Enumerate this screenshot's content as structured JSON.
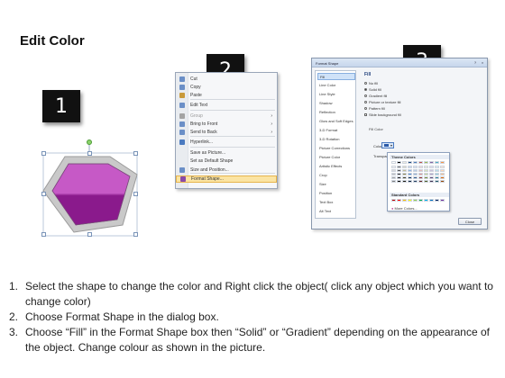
{
  "title": "Edit Color",
  "steps": [
    "1",
    "2",
    "3"
  ],
  "shape": {
    "fill_top": "#c659c6",
    "fill_bottom": "#8a1a8c",
    "outline": "#9b9b9b"
  },
  "context_menu": {
    "items": [
      {
        "label": "Cut",
        "icon": "scissors-icon"
      },
      {
        "label": "Copy",
        "icon": "copy-icon"
      },
      {
        "label": "Paste",
        "icon": "paste-icon"
      },
      {
        "label": "Edit Text",
        "icon": "edit-text-icon"
      },
      {
        "label": "Group",
        "icon": "group-icon",
        "submenu": true,
        "disabled": true
      },
      {
        "label": "Bring to Front",
        "icon": "bring-front-icon",
        "submenu": true
      },
      {
        "label": "Send to Back",
        "icon": "send-back-icon",
        "submenu": true
      },
      {
        "label": "Hyperlink...",
        "icon": "hyperlink-icon"
      },
      {
        "label": "Save as Picture...",
        "icon": ""
      },
      {
        "label": "Set as Default Shape",
        "icon": ""
      },
      {
        "label": "Size and Position...",
        "icon": "size-position-icon"
      },
      {
        "label": "Format Shape...",
        "icon": "format-shape-icon",
        "highlight": true
      }
    ],
    "submenu_arrow": "›"
  },
  "dialog": {
    "title": "Format Shape",
    "categories": [
      "Fill",
      "Line Color",
      "Line Style",
      "Shadow",
      "Reflection",
      "Glow and Soft Edges",
      "3-D Format",
      "3-D Rotation",
      "Picture Corrections",
      "Picture Color",
      "Artistic Effects",
      "Crop",
      "Size",
      "Position",
      "Text Box",
      "Alt Text"
    ],
    "section": "Fill",
    "options": [
      {
        "label": "No fill",
        "type": "radio",
        "on": false
      },
      {
        "label": "Solid fill",
        "type": "radio",
        "on": true
      },
      {
        "label": "Gradient fill",
        "type": "radio",
        "on": false
      },
      {
        "label": "Picture or texture fill",
        "type": "radio",
        "on": false
      },
      {
        "label": "Pattern fill",
        "type": "radio",
        "on": false
      },
      {
        "label": "Slide background fill",
        "type": "check",
        "on": false
      }
    ],
    "fill_color_label": "Fill Color",
    "color_label": "Color:",
    "transparency_label": "Transpar",
    "theme_colors_label": "Theme Colors",
    "standard_colors_label": "Standard Colors",
    "more_colors_label": "More Colors...",
    "close_label": "Close",
    "title_buttons": [
      "?",
      "×"
    ],
    "theme_colors": [
      "#ffffff",
      "#000000",
      "#eeece1",
      "#1f497d",
      "#4f81bd",
      "#c0504d",
      "#9bbb59",
      "#8064a2",
      "#4bacc6",
      "#f79646"
    ],
    "shade_rows": [
      [
        "#f2f2f2",
        "#7f7f7f",
        "#ddd9c3",
        "#c6d9f0",
        "#dbe5f1",
        "#f2dcdb",
        "#ebf1dd",
        "#e5e0ec",
        "#dbeef3",
        "#fdeada"
      ],
      [
        "#d8d8d8",
        "#595959",
        "#c4bd97",
        "#8db3e2",
        "#b8cce4",
        "#e5b9b7",
        "#d7e3bc",
        "#ccc1d9",
        "#b7dde8",
        "#fbd5b5"
      ],
      [
        "#bfbfbf",
        "#3f3f3f",
        "#938953",
        "#548dd4",
        "#95b3d7",
        "#d99694",
        "#c3d69b",
        "#b2a2c7",
        "#92cddc",
        "#fac08f"
      ],
      [
        "#a5a5a5",
        "#262626",
        "#494429",
        "#17365d",
        "#366092",
        "#953734",
        "#76923c",
        "#5f497a",
        "#31859b",
        "#e36c09"
      ],
      [
        "#7f7f7f",
        "#0c0c0c",
        "#1d1b10",
        "#0f243e",
        "#244061",
        "#632423",
        "#4f6128",
        "#3f3151",
        "#205867",
        "#974806"
      ]
    ],
    "standard_colors": [
      "#c00000",
      "#ff0000",
      "#ffc000",
      "#ffff00",
      "#92d050",
      "#00b050",
      "#00b0f0",
      "#0070c0",
      "#002060",
      "#7030a0"
    ]
  },
  "instructions": [
    {
      "num": "1.",
      "text": "Select the shape to change the color and Right click the object( click any object which you want to change color)"
    },
    {
      "num": "2.",
      "text": "Choose Format Shape in the dialog box."
    },
    {
      "num": "3.",
      "text": "Choose “Fill” in the Format Shape box then “Solid” or “Gradient” depending on the appearance of the object. Change colour as shown in the picture."
    }
  ]
}
